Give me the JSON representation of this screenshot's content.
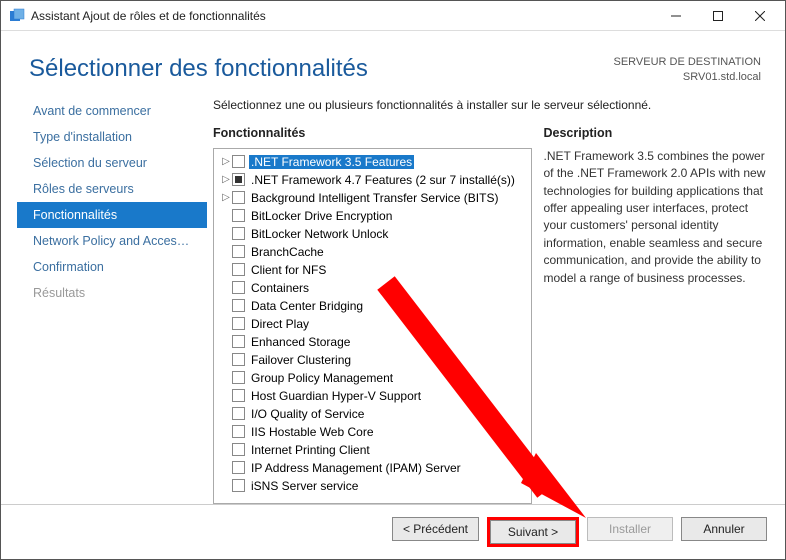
{
  "window": {
    "title": "Assistant Ajout de rôles et de fonctionnalités"
  },
  "header": {
    "title": "Sélectionner des fonctionnalités",
    "dest_label": "SERVEUR DE DESTINATION",
    "dest_value": "SRV01.std.local"
  },
  "steps": {
    "items": [
      {
        "label": "Avant de commencer"
      },
      {
        "label": "Type d'installation"
      },
      {
        "label": "Sélection du serveur"
      },
      {
        "label": "Rôles de serveurs"
      },
      {
        "label": "Fonctionnalités"
      },
      {
        "label": "Network Policy and Acces…"
      },
      {
        "label": "Confirmation"
      },
      {
        "label": "Résultats"
      }
    ]
  },
  "main": {
    "intro": "Sélectionnez une ou plusieurs fonctionnalités à installer sur le serveur sélectionné.",
    "features_heading": "Fonctionnalités",
    "description_heading": "Description",
    "description_text": ".NET Framework 3.5 combines the power of the .NET Framework 2.0 APIs with new technologies for building applications that offer appealing user interfaces, protect your customers' personal identity information, enable seamless and secure communication, and provide the ability to model a range of business processes."
  },
  "features": [
    {
      "label": ".NET Framework 3.5 Features",
      "expandable": true,
      "selected": true,
      "check": "unchecked"
    },
    {
      "label": ".NET Framework 4.7 Features (2 sur 7 installé(s))",
      "expandable": true,
      "check": "partial"
    },
    {
      "label": "Background Intelligent Transfer Service (BITS)",
      "expandable": true,
      "check": "unchecked"
    },
    {
      "label": "BitLocker Drive Encryption",
      "check": "unchecked"
    },
    {
      "label": "BitLocker Network Unlock",
      "check": "unchecked"
    },
    {
      "label": "BranchCache",
      "check": "unchecked"
    },
    {
      "label": "Client for NFS",
      "check": "unchecked"
    },
    {
      "label": "Containers",
      "check": "unchecked"
    },
    {
      "label": "Data Center Bridging",
      "check": "unchecked"
    },
    {
      "label": "Direct Play",
      "check": "unchecked"
    },
    {
      "label": "Enhanced Storage",
      "check": "unchecked"
    },
    {
      "label": "Failover Clustering",
      "check": "unchecked"
    },
    {
      "label": "Group Policy Management",
      "check": "unchecked"
    },
    {
      "label": "Host Guardian Hyper-V Support",
      "check": "unchecked"
    },
    {
      "label": "I/O Quality of Service",
      "check": "unchecked"
    },
    {
      "label": "IIS Hostable Web Core",
      "check": "unchecked"
    },
    {
      "label": "Internet Printing Client",
      "check": "unchecked"
    },
    {
      "label": "IP Address Management (IPAM) Server",
      "check": "unchecked"
    },
    {
      "label": "iSNS Server service",
      "check": "unchecked"
    }
  ],
  "footer": {
    "prev": "< Précédent",
    "next": "Suivant >",
    "install": "Installer",
    "cancel": "Annuler"
  }
}
